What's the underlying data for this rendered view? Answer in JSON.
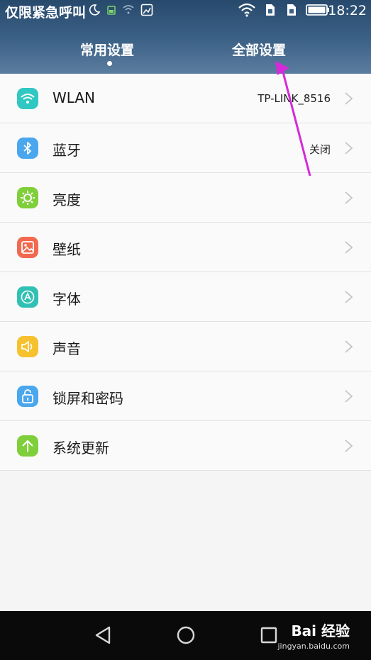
{
  "status_bar": {
    "left_text": "仅限紧急呼叫",
    "time": "18:22"
  },
  "tabs": [
    {
      "label": "常用设置",
      "selected": true
    },
    {
      "label": "全部设置",
      "selected": false
    }
  ],
  "settings": [
    {
      "label": "WLAN",
      "value": "TP-LINK_8516",
      "icon": "wifi-icon",
      "color": "#31c8c3"
    },
    {
      "label": "蓝牙",
      "value": "关闭",
      "icon": "bluetooth-icon",
      "color": "#4aa7ee"
    },
    {
      "label": "亮度",
      "value": "",
      "icon": "brightness-icon",
      "color": "#7fcf3b"
    },
    {
      "label": "壁纸",
      "value": "",
      "icon": "wallpaper-icon",
      "color": "#f2694f"
    },
    {
      "label": "字体",
      "value": "",
      "icon": "font-icon",
      "color": "#31c0b4"
    },
    {
      "label": "声音",
      "value": "",
      "icon": "sound-icon",
      "color": "#f6c12e"
    },
    {
      "label": "锁屏和密码",
      "value": "",
      "icon": "lock-icon",
      "color": "#4aa7ee"
    },
    {
      "label": "系统更新",
      "value": "",
      "icon": "update-arrow-icon",
      "color": "#7fcf3b"
    }
  ],
  "watermark": {
    "brand": "Bai 经验",
    "url": "jingyan.baidu.com"
  },
  "annotation": {
    "color": "#d62ad9"
  }
}
